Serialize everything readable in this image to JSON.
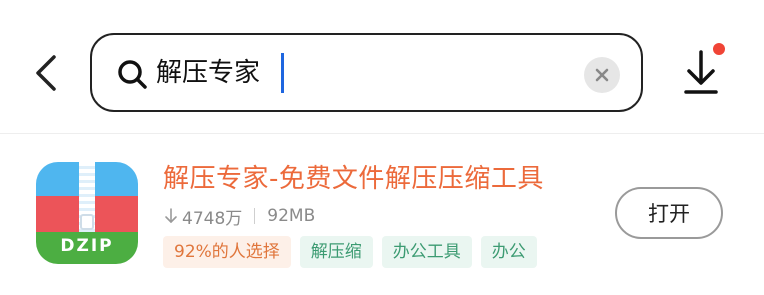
{
  "search": {
    "query": "解压专家"
  },
  "header": {
    "back_icon": "chevron-left-icon",
    "search_icon": "search-icon",
    "clear_icon": "close-icon",
    "download_icon": "download-icon",
    "notification_color": "#f04436"
  },
  "result": {
    "icon": {
      "label": "DZIP",
      "colors": [
        "#4fb6ef",
        "#ec5459",
        "#4cae42"
      ]
    },
    "title": "解压专家-免费文件解压压缩工具",
    "downloads": "4748万",
    "size": "92MB",
    "tags": [
      {
        "label": "92%的人选择",
        "style": "orange"
      },
      {
        "label": "解压缩",
        "style": "green"
      },
      {
        "label": "办公工具",
        "style": "green"
      },
      {
        "label": "办公",
        "style": "green"
      }
    ],
    "action_label": "打开",
    "title_color": "#ec6a3b"
  }
}
